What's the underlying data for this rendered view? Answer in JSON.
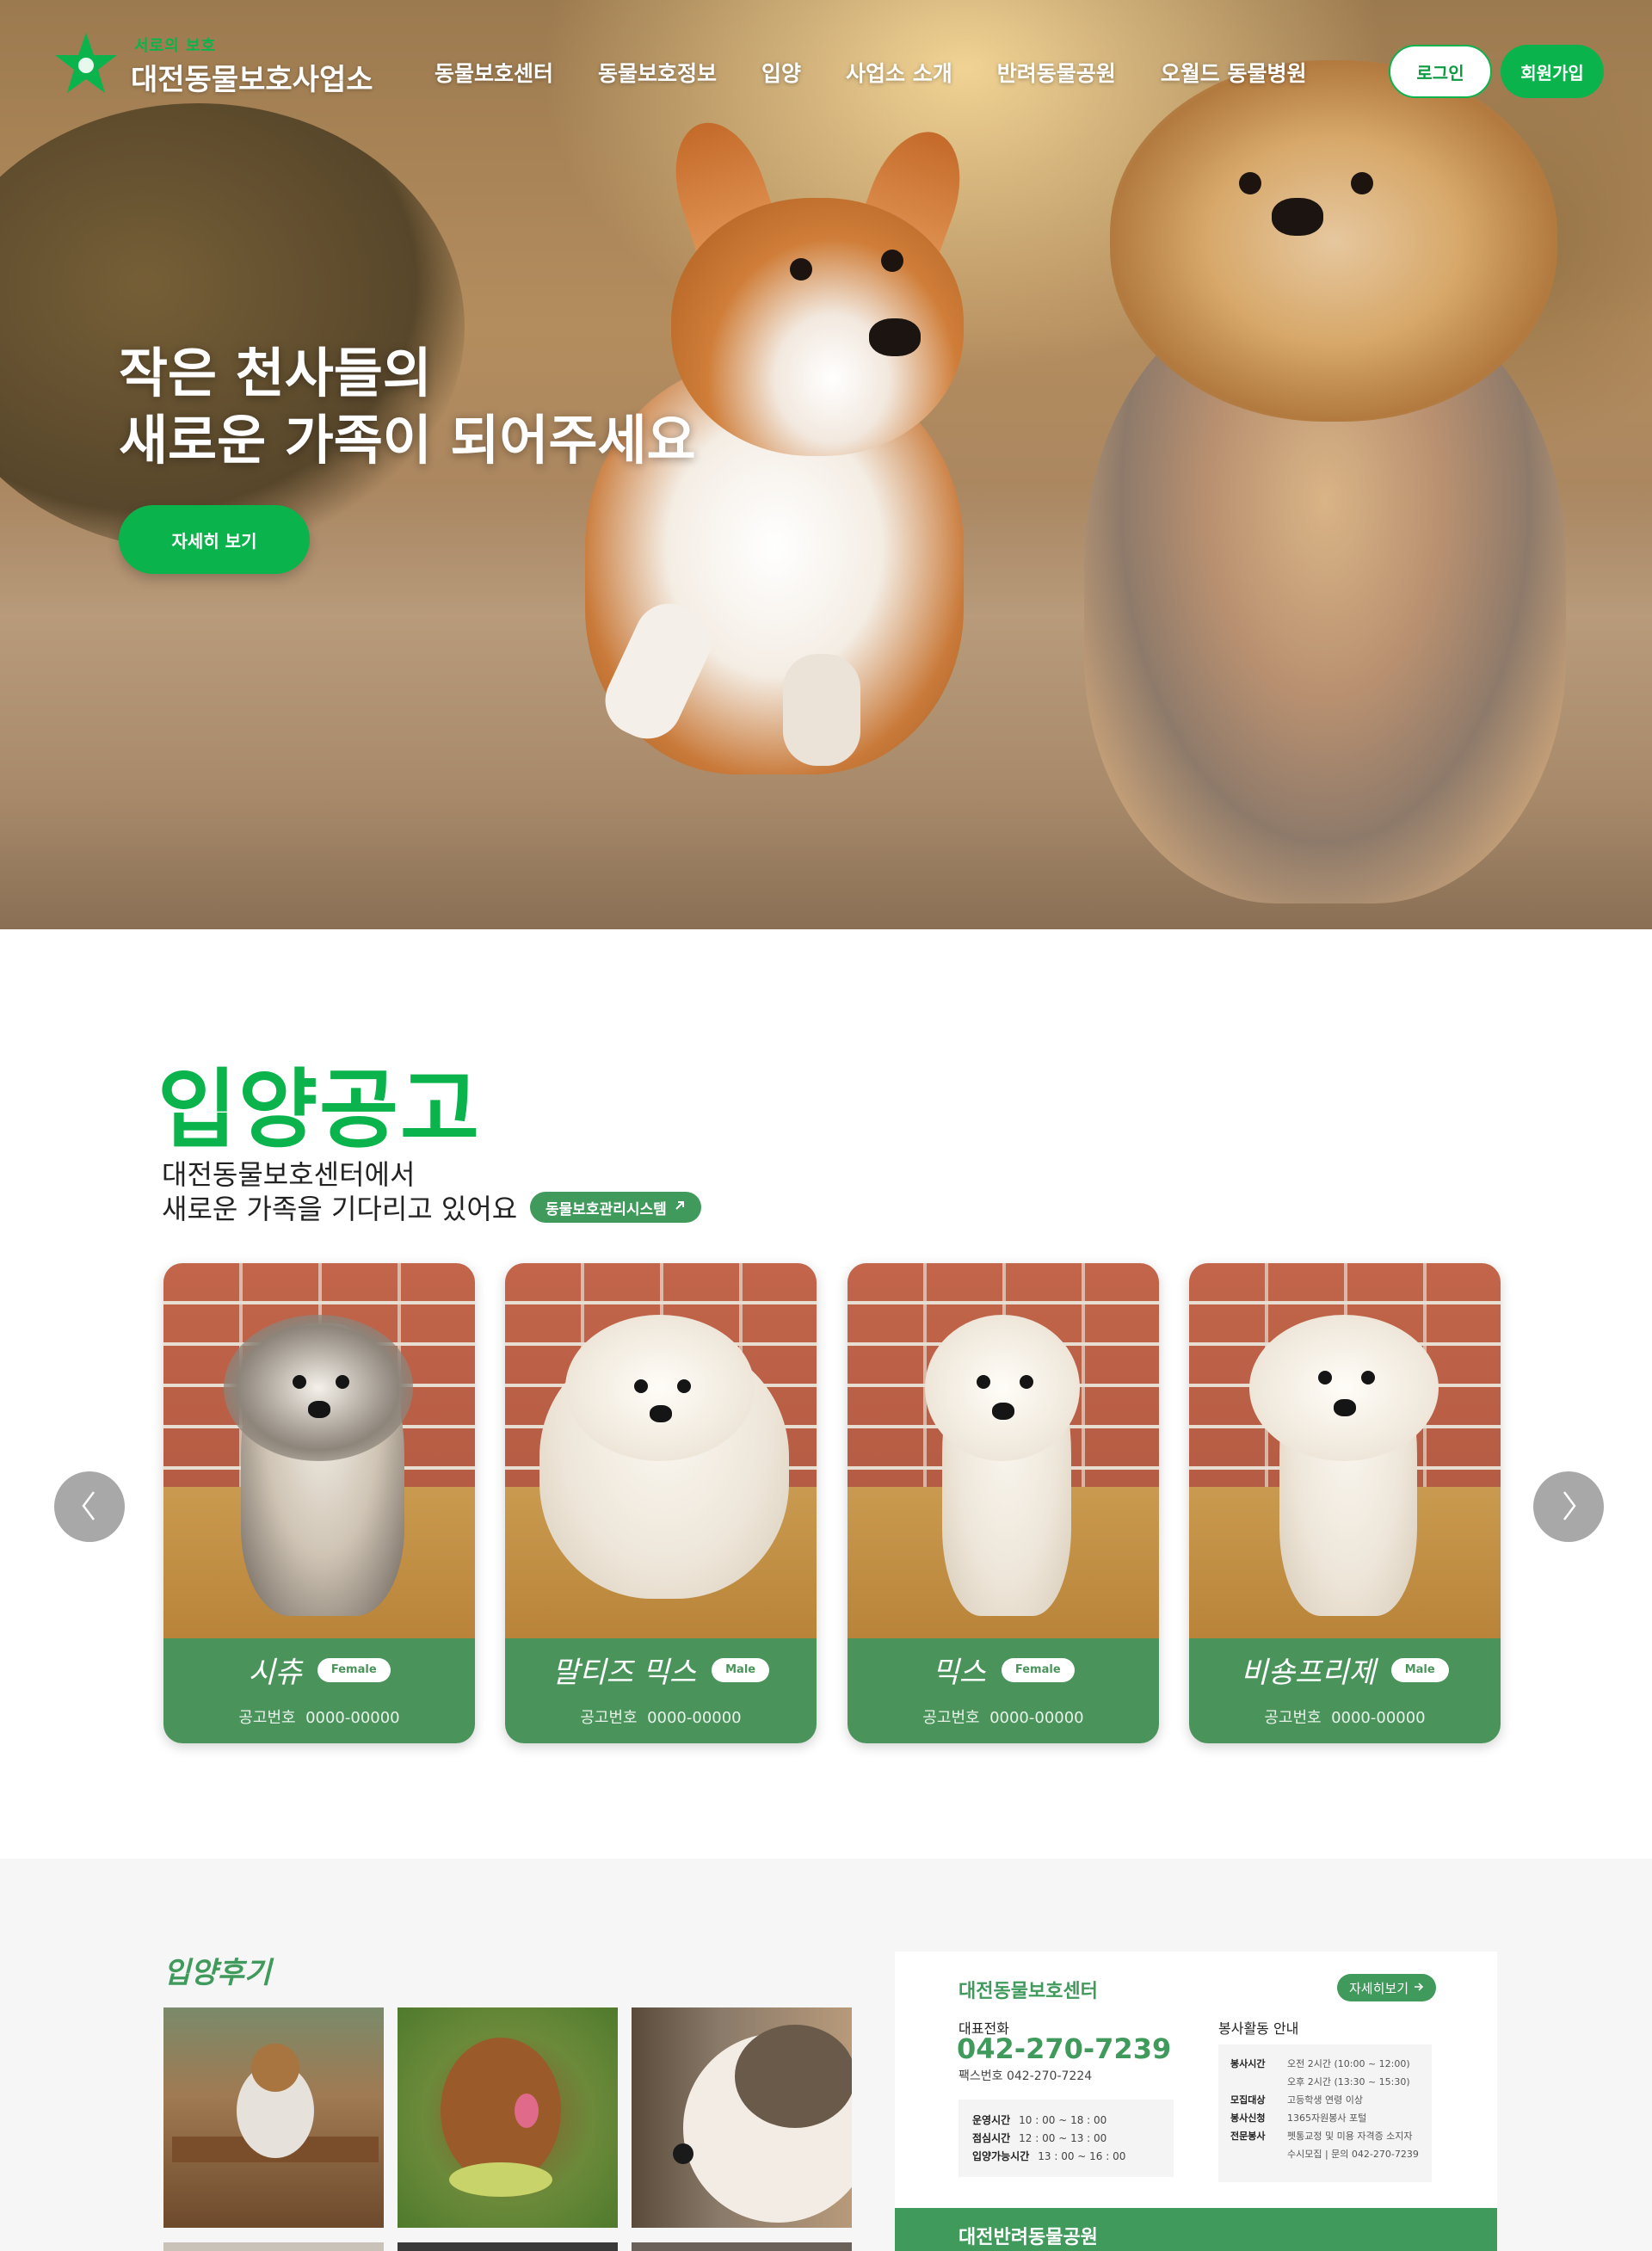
{
  "header": {
    "logo_sub": "서로의 보호",
    "logo_name": "대전동물보호사업소",
    "nav": [
      "동물보호센터",
      "동물보호정보",
      "입양",
      "사업소 소개",
      "반려동물공원",
      "오월드 동물병원"
    ],
    "login": "로그인",
    "join": "회원가입"
  },
  "hero": {
    "title": "작은 천사들의\n새로운 가족이 되어주세요",
    "button": "자세히 보기"
  },
  "adoption": {
    "title": "입양공고",
    "desc": "대전동물보호센터에서\n새로운 가족을 기다리고 있어요",
    "system_link": "동물보호관리시스템",
    "cards": [
      {
        "breed": "시츄",
        "sex": "Female",
        "notice_label": "공고번호",
        "notice_no": "0000-00000"
      },
      {
        "breed": "말티즈 믹스",
        "sex": "Male",
        "notice_label": "공고번호",
        "notice_no": "0000-00000"
      },
      {
        "breed": "믹스",
        "sex": "Female",
        "notice_label": "공고번호",
        "notice_no": "0000-00000"
      },
      {
        "breed": "비숑프리제",
        "sex": "Male",
        "notice_label": "공고번호",
        "notice_no": "0000-00000"
      }
    ]
  },
  "review": {
    "title": "입양후기"
  },
  "center": {
    "title": "대전동물보호센터",
    "more": "자세히보기",
    "phone_label": "대표전화",
    "phone": "042-270-7239",
    "fax": "팩스번호 042-270-7224",
    "hours": [
      {
        "k": "운영시간",
        "v": "10 : 00 ~ 18 : 00"
      },
      {
        "k": "점심시간",
        "v": "12 : 00 ~ 13 : 00"
      },
      {
        "k": "입양가능시간",
        "v": "13 : 00 ~ 16 : 00"
      }
    ],
    "volunteer_title": "봉사활동 안내",
    "volunteer": [
      {
        "k": "봉사시간",
        "v": "오전 2시간 (10:00 ~ 12:00)"
      },
      {
        "k": "",
        "v": "오후 2시간 (13:30 ~ 15:30)"
      },
      {
        "k": "모집대상",
        "v": "고등학생 연령 이상"
      },
      {
        "k": "봉사신청",
        "v": "1365자원봉사 포털"
      },
      {
        "k": "전문봉사",
        "v": "펫통교정 및 미용 자격증 소지자"
      },
      {
        "k": "",
        "v": "수시모집 | 문의 042-270-7239"
      }
    ]
  },
  "park": {
    "title": "대전반려동물공원"
  },
  "colors": {
    "brand_green": "#0bb34c",
    "card_green": "#4a945c",
    "panel_green": "#3f9a5b"
  }
}
